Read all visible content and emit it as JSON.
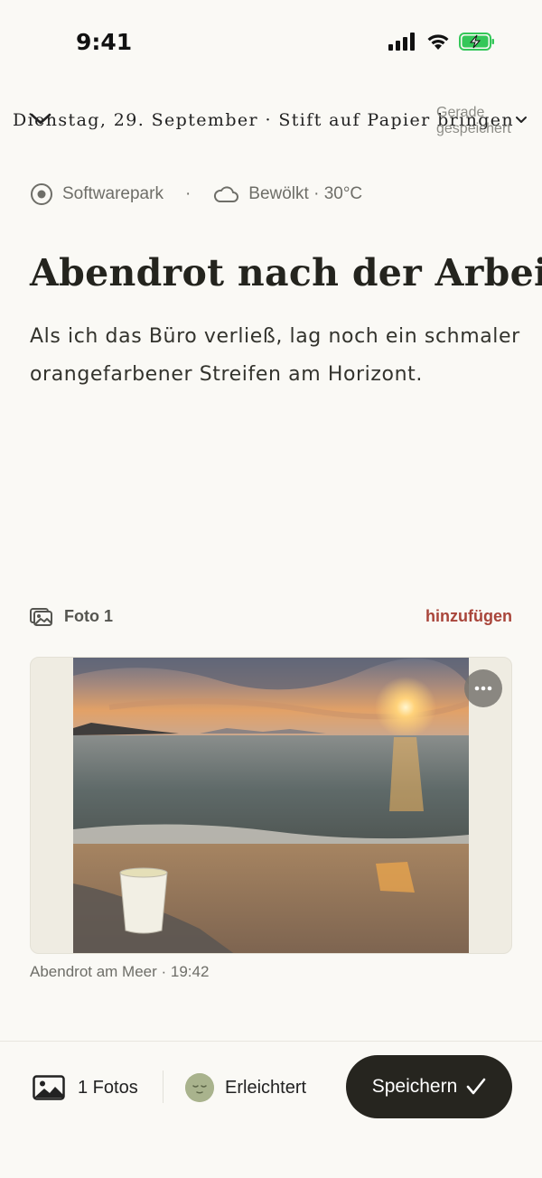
{
  "status_bar": {
    "time": "9:41"
  },
  "nav": {
    "title": "Dienstag, 29. September · Stift auf Papier bringen",
    "save_status": "Gerade gespeichert"
  },
  "meta": {
    "location": "Softwarepark",
    "separator": "·",
    "weather": "Bewölkt · 30°C"
  },
  "entry": {
    "title": "Abendrot nach der Arbeit",
    "body": "Als ich das Büro verließ, lag noch ein schmaler orangefarbener Streifen am Horizont."
  },
  "photos": {
    "label": "Foto 1",
    "add_label": "hinzufügen",
    "caption": "Abendrot am Meer · 19:42"
  },
  "bottom_bar": {
    "photos_count_label": "1 Fotos",
    "mood_label": "Erleichtert",
    "save_label": "Speichern"
  },
  "colors": {
    "background": "#faf9f5",
    "accent_link": "#a9453a",
    "save_button": "#26251f",
    "battery": "#34c759",
    "mood": "#a9b38d"
  },
  "icons": [
    "signal-icon",
    "wifi-icon",
    "battery-charging-icon",
    "chevron-down-icon",
    "location-icon",
    "cloud-icon",
    "photos-icon",
    "more-icon",
    "image-icon",
    "mood-face-icon",
    "checkmark-icon"
  ]
}
